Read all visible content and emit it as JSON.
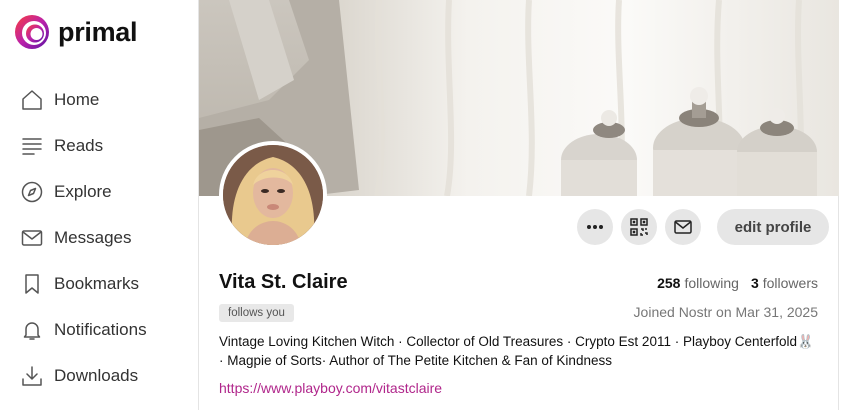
{
  "app": {
    "logo_text": "primal"
  },
  "sidebar": {
    "items": [
      {
        "label": "Home",
        "icon": "home-icon"
      },
      {
        "label": "Reads",
        "icon": "reads-icon"
      },
      {
        "label": "Explore",
        "icon": "compass-icon"
      },
      {
        "label": "Messages",
        "icon": "envelope-icon"
      },
      {
        "label": "Bookmarks",
        "icon": "bookmark-icon"
      },
      {
        "label": "Notifications",
        "icon": "bell-icon"
      },
      {
        "label": "Downloads",
        "icon": "download-icon"
      }
    ]
  },
  "profile": {
    "display_name": "Vita St. Claire",
    "following_count": "258",
    "following_label": "following",
    "followers_count": "3",
    "followers_label": "followers",
    "follows_you_badge": "follows you",
    "joined_text": "Joined Nostr on Mar 31, 2025",
    "bio": "Vintage Loving Kitchen Witch · Collector of Old Treasures · Crypto Est 2011 · Playboy Centerfold🐰 · Magpie of Sorts· Author of The Petite Kitchen & Fan of Kindness",
    "website": "https://www.playboy.com/vitastclaire",
    "edit_button_label": "edit profile"
  },
  "colors": {
    "accent_link": "#b0268b",
    "button_bg": "#e6e6e6"
  }
}
